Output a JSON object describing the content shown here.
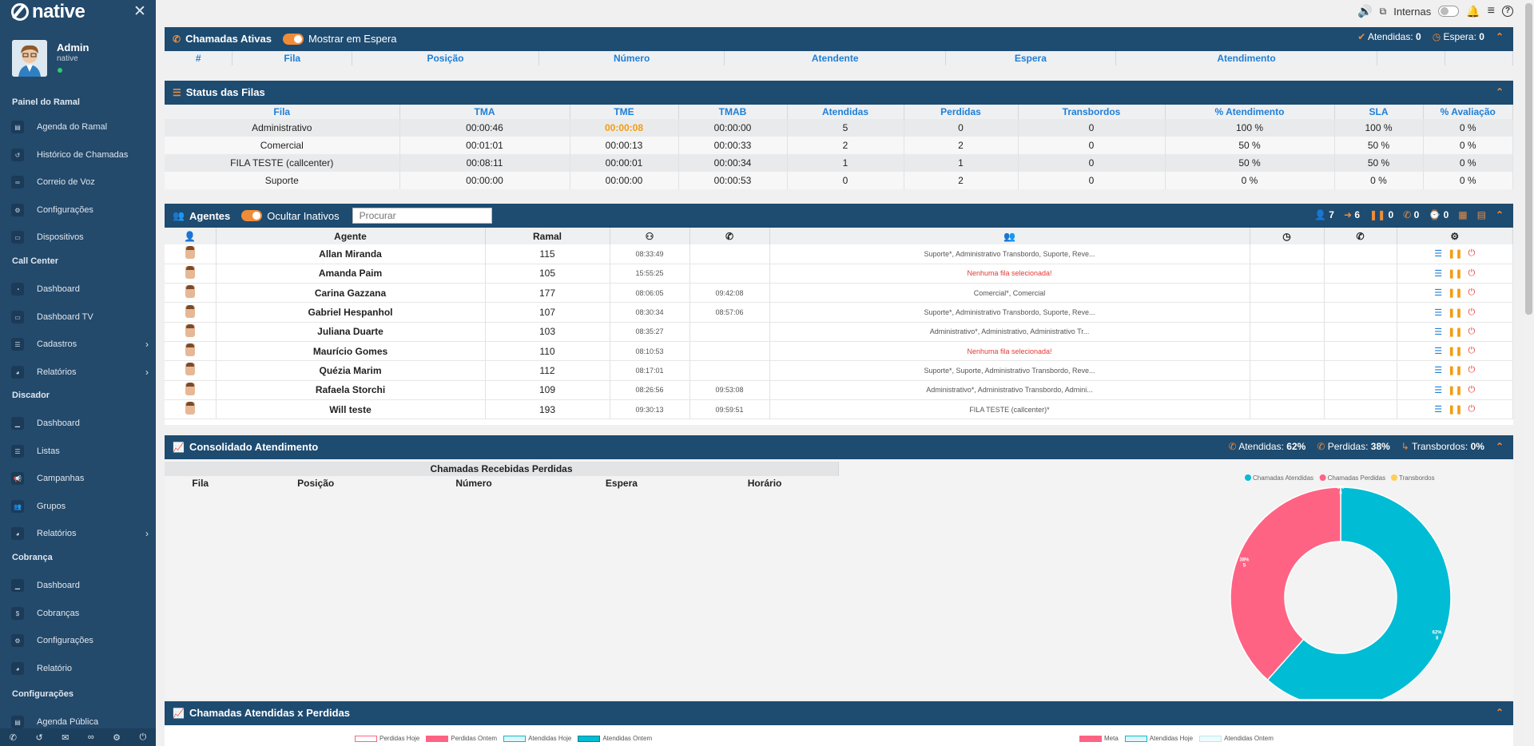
{
  "app": {
    "logo": "native"
  },
  "user": {
    "name": "Admin",
    "role": "native"
  },
  "sidebar": {
    "sections": [
      {
        "title": "Painel do Ramal",
        "items": [
          {
            "label": "Agenda do Ramal",
            "icon": "address-book-icon"
          },
          {
            "label": "Histórico de Chamadas",
            "icon": "history-icon"
          },
          {
            "label": "Correio de Voz",
            "icon": "voicemail-icon"
          },
          {
            "label": "Configurações",
            "icon": "gear-icon"
          },
          {
            "label": "Dispositivos",
            "icon": "desktop-icon"
          }
        ]
      },
      {
        "title": "Call Center",
        "items": [
          {
            "label": "Dashboard",
            "icon": "dashboard-icon"
          },
          {
            "label": "Dashboard TV",
            "icon": "tv-icon"
          },
          {
            "label": "Cadastros",
            "icon": "list-icon",
            "chevron": true
          },
          {
            "label": "Relatórios",
            "icon": "chart-pie-icon",
            "chevron": true
          }
        ]
      },
      {
        "title": "Discador",
        "items": [
          {
            "label": "Dashboard",
            "icon": "chart-area-icon"
          },
          {
            "label": "Listas",
            "icon": "list-icon"
          },
          {
            "label": "Campanhas",
            "icon": "bullhorn-icon"
          },
          {
            "label": "Grupos",
            "icon": "users-icon"
          },
          {
            "label": "Relatórios",
            "icon": "chart-pie-icon",
            "chevron": true
          }
        ]
      },
      {
        "title": "Cobrança",
        "items": [
          {
            "label": "Dashboard",
            "icon": "chart-area-icon"
          },
          {
            "label": "Cobranças",
            "icon": "dollar-icon"
          },
          {
            "label": "Configurações",
            "icon": "gear-icon"
          },
          {
            "label": "Relatório",
            "icon": "chart-pie-icon"
          }
        ]
      },
      {
        "title": "Configurações",
        "items": [
          {
            "label": "Agenda Pública",
            "icon": "address-book-icon"
          }
        ]
      }
    ]
  },
  "topbar": {
    "internas_label": "Internas"
  },
  "active_calls": {
    "title": "Chamadas Ativas",
    "toggle_label": "Mostrar em Espera",
    "atendidas_label": "Atendidas:",
    "atendidas_value": "0",
    "espera_label": "Espera:",
    "espera_value": "0",
    "columns": [
      "#",
      "Fila",
      "Posição",
      "Número",
      "Atendente",
      "Espera",
      "Atendimento",
      "",
      ""
    ]
  },
  "queue_status": {
    "title": "Status das Filas",
    "columns": [
      "Fila",
      "TMA",
      "TME",
      "TMAB",
      "Atendidas",
      "Perdidas",
      "Transbordos",
      "% Atendimento",
      "SLA",
      "% Avaliação"
    ],
    "rows": [
      [
        "Administrativo",
        "00:00:46",
        "00:00:08",
        "00:00:00",
        "5",
        "0",
        "0",
        "100 %",
        "100 %",
        "0 %"
      ],
      [
        "Comercial",
        "00:01:01",
        "00:00:13",
        "00:00:33",
        "2",
        "2",
        "0",
        "50 %",
        "50 %",
        "0 %"
      ],
      [
        "FILA TESTE (callcenter)",
        "00:08:11",
        "00:00:01",
        "00:00:34",
        "1",
        "1",
        "0",
        "50 %",
        "50 %",
        "0 %"
      ],
      [
        "Suporte",
        "00:00:00",
        "00:00:00",
        "00:00:53",
        "0",
        "2",
        "0",
        "0 %",
        "0 %",
        "0 %"
      ]
    ]
  },
  "agents": {
    "title": "Agentes",
    "toggle_label": "Ocultar Inativos",
    "search_placeholder": "Procurar",
    "counters": [
      "7",
      "6",
      "0",
      "0",
      "0"
    ],
    "columns": {
      "agent": "Agente",
      "ramal": "Ramal"
    },
    "rows": [
      {
        "name": "Allan Miranda",
        "ramal": "115",
        "login": "08:33:49",
        "call": "",
        "queues": "Suporte*, Administrativo Transbordo, Suporte, Reve...",
        "no_queue": false
      },
      {
        "name": "Amanda Paim",
        "ramal": "105",
        "login": "15:55:25",
        "call": "",
        "queues": "Nenhuma fila selecionada!",
        "no_queue": true
      },
      {
        "name": "Carina Gazzana",
        "ramal": "177",
        "login": "08:06:05",
        "call": "09:42:08",
        "queues": "Comercial*, Comercial",
        "no_queue": false
      },
      {
        "name": "Gabriel Hespanhol",
        "ramal": "107",
        "login": "08:30:34",
        "call": "08:57:06",
        "queues": "Suporte*, Administrativo Transbordo, Suporte, Reve...",
        "no_queue": false
      },
      {
        "name": "Juliana Duarte",
        "ramal": "103",
        "login": "08:35:27",
        "call": "",
        "queues": "Administrativo*, Administrativo, Administrativo Tr...",
        "no_queue": false
      },
      {
        "name": "Maurício Gomes",
        "ramal": "110",
        "login": "08:10:53",
        "call": "",
        "queues": "Nenhuma fila selecionada!",
        "no_queue": true
      },
      {
        "name": "Quézia Marim",
        "ramal": "112",
        "login": "08:17:01",
        "call": "",
        "queues": "Suporte*, Suporte, Administrativo Transbordo, Reve...",
        "no_queue": false
      },
      {
        "name": "Rafaela Storchi",
        "ramal": "109",
        "login": "08:26:56",
        "call": "09:53:08",
        "queues": "Administrativo*, Administrativo Transbordo, Admini...",
        "no_queue": false
      },
      {
        "name": "Will teste",
        "ramal": "193",
        "login": "09:30:13",
        "call": "09:59:51",
        "queues": "FILA TESTE (callcenter)*",
        "no_queue": false
      }
    ]
  },
  "consolidated": {
    "title": "Consolidado Atendimento",
    "atendidas_label": "Atendidas:",
    "atendidas_value": "62%",
    "perdidas_label": "Perdidas:",
    "perdidas_value": "38%",
    "transbordos_label": "Transbordos:",
    "transbordos_value": "0%",
    "lost_table_title": "Chamadas Recebidas Perdidas",
    "lost_columns": [
      "Fila",
      "Posição",
      "Número",
      "Espera",
      "Horário"
    ],
    "colors": {
      "atendidas": "#00bcd4",
      "perdidas": "#ff6384",
      "transbordos": "#ffce56"
    }
  },
  "chart_data": {
    "type": "pie",
    "categories": [
      "Chamadas Atendidas",
      "Chamadas Perdidas",
      "Transbordos"
    ],
    "values": [
      8,
      5,
      0
    ],
    "labels": [
      "62%\n8",
      "38%\n5",
      "0%\n0"
    ]
  },
  "atendidas_perdidas": {
    "title": "Chamadas Atendidas x Perdidas",
    "legend_left": [
      "Perdidas Hoje",
      "Perdidas Ontem",
      "Atendidas Hoje",
      "Atendidas Ontem"
    ],
    "legend_right": [
      "Meta",
      "Atendidas Hoje",
      "Atendidas Ontem"
    ]
  }
}
